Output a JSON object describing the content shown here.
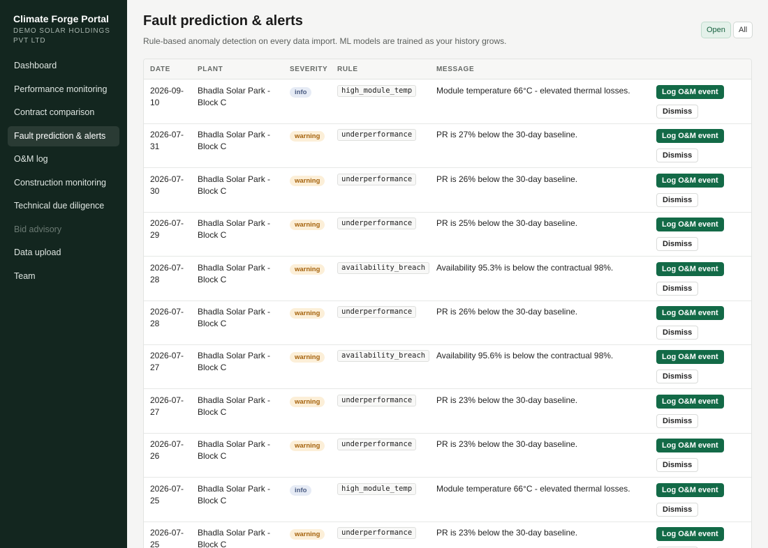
{
  "sidebar": {
    "brand": "Climate Forge Portal",
    "org": "DEMO SOLAR HOLDINGS PVT LTD",
    "items": [
      {
        "label": "Dashboard"
      },
      {
        "label": "Performance monitoring"
      },
      {
        "label": "Contract comparison"
      },
      {
        "label": "Fault prediction & alerts"
      },
      {
        "label": "O&M log"
      },
      {
        "label": "Construction monitoring"
      },
      {
        "label": "Technical due diligence"
      },
      {
        "label": "Bid advisory"
      },
      {
        "label": "Data upload"
      },
      {
        "label": "Team"
      }
    ]
  },
  "header": {
    "title": "Fault prediction & alerts",
    "subtitle": "Rule-based anomaly detection on every data import. ML models are trained as your history grows."
  },
  "filters": {
    "open": "Open",
    "all": "All",
    "selected": "Open"
  },
  "table": {
    "headers": {
      "date": "DATE",
      "plant": "PLANT",
      "severity": "SEVERITY",
      "rule": "RULE",
      "message": "MESSAGE"
    },
    "log_label": "Log O&M event",
    "dismiss_label": "Dismiss",
    "rows": [
      {
        "date": "2026-09-10",
        "plant": "Bhadla Solar Park - Block C",
        "severity": "info",
        "rule": "high_module_temp",
        "message": "Module temperature 66°C - elevated thermal losses."
      },
      {
        "date": "2026-07-31",
        "plant": "Bhadla Solar Park - Block C",
        "severity": "warning",
        "rule": "underperformance",
        "message": "PR is 27% below the 30-day baseline."
      },
      {
        "date": "2026-07-30",
        "plant": "Bhadla Solar Park - Block C",
        "severity": "warning",
        "rule": "underperformance",
        "message": "PR is 26% below the 30-day baseline."
      },
      {
        "date": "2026-07-29",
        "plant": "Bhadla Solar Park - Block C",
        "severity": "warning",
        "rule": "underperformance",
        "message": "PR is 25% below the 30-day baseline."
      },
      {
        "date": "2026-07-28",
        "plant": "Bhadla Solar Park - Block C",
        "severity": "warning",
        "rule": "availability_breach",
        "message": "Availability 95.3% is below the contractual 98%."
      },
      {
        "date": "2026-07-28",
        "plant": "Bhadla Solar Park - Block C",
        "severity": "warning",
        "rule": "underperformance",
        "message": "PR is 26% below the 30-day baseline."
      },
      {
        "date": "2026-07-27",
        "plant": "Bhadla Solar Park - Block C",
        "severity": "warning",
        "rule": "availability_breach",
        "message": "Availability 95.6% is below the contractual 98%."
      },
      {
        "date": "2026-07-27",
        "plant": "Bhadla Solar Park - Block C",
        "severity": "warning",
        "rule": "underperformance",
        "message": "PR is 23% below the 30-day baseline."
      },
      {
        "date": "2026-07-26",
        "plant": "Bhadla Solar Park - Block C",
        "severity": "warning",
        "rule": "underperformance",
        "message": "PR is 23% below the 30-day baseline."
      },
      {
        "date": "2026-07-25",
        "plant": "Bhadla Solar Park - Block C",
        "severity": "info",
        "rule": "high_module_temp",
        "message": "Module temperature 66°C - elevated thermal losses."
      },
      {
        "date": "2026-07-25",
        "plant": "Bhadla Solar Park - Block C",
        "severity": "warning",
        "rule": "underperformance",
        "message": "PR is 23% below the 30-day baseline."
      }
    ]
  }
}
